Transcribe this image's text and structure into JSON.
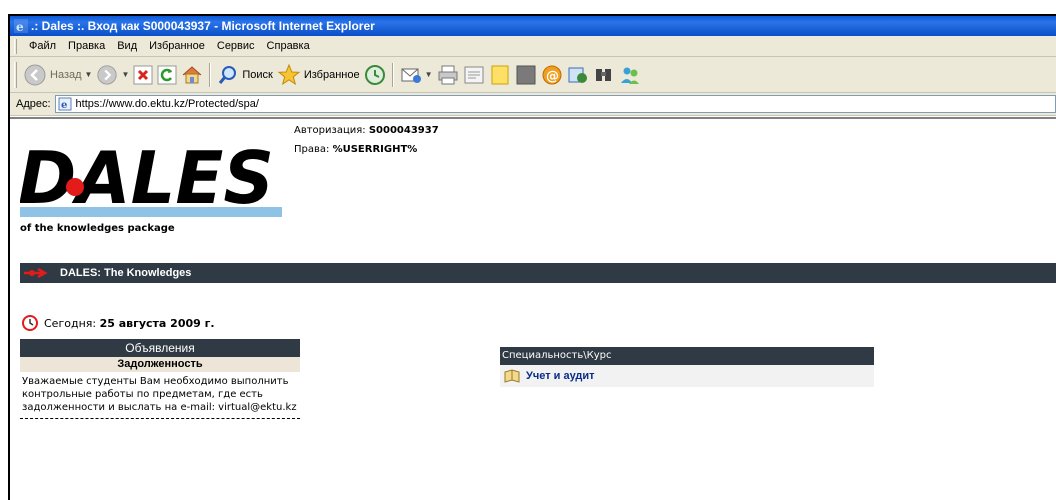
{
  "window": {
    "title": ".: Dales :. Вход как S000043937 - Microsoft Internet Explorer"
  },
  "menu": {
    "items": [
      "Файл",
      "Правка",
      "Вид",
      "Избранное",
      "Сервис",
      "Справка"
    ]
  },
  "toolbar": {
    "back_label": "Назад",
    "search_label": "Поиск",
    "favorites_label": "Избранное"
  },
  "address": {
    "label": "Адрес:",
    "url": "https://www.do.ektu.kz/Protected/spa/"
  },
  "logo": {
    "text": "DALES",
    "subtitle": "of the knowledges package"
  },
  "auth": {
    "auth_label": "Авторизация:",
    "auth_value": "S000043937",
    "rights_label": "Права:",
    "rights_value": "%USERRIGHT%"
  },
  "banner": {
    "text": "DALES: The Knowledges"
  },
  "today": {
    "label": "Сегодня:",
    "date": "25 августа 2009 г."
  },
  "announcements": {
    "title": "Объявления",
    "subtitle": "Задолженность",
    "body": "Уважаемые студенты Вам необходимо выполнить контрольные работы по предметам, где есть задолженности и выслать на e-mail: virtual@ektu.kz"
  },
  "specialty": {
    "header": "Специальность\\Курс",
    "course": "Учет и аудит"
  },
  "colors": {
    "title_blue": "#0a5ad9",
    "banner_dark": "#2f3a44",
    "logo_red": "#e31b1b",
    "logo_bar_blue": "#8fc3e6",
    "link_blue": "#0a2c8a"
  }
}
